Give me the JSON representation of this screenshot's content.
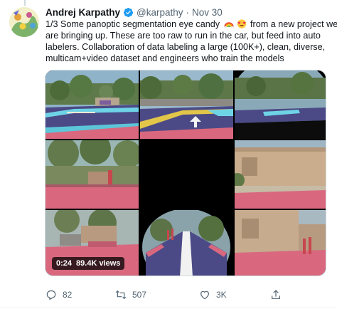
{
  "tweet": {
    "author_name": "Andrej Karpathy",
    "handle": "@karpathy",
    "separator": "·",
    "date": "Nov 30",
    "text_lines": [
      {
        "before": "1/3 Some panoptic segmentation eye candy ",
        "after": " from a new project we"
      },
      "are bringing up. These are too raw to run in the car, but feed into auto",
      "labelers. Collaboration of data labeling a large (100K+), clean, diverse,",
      "multicam+video dataset and engineers who train the models"
    ],
    "emojis": [
      "rainbow",
      "smiling-face-with-heart-eyes"
    ]
  },
  "video": {
    "duration": "0:24",
    "views": "89.4K views"
  },
  "actions": {
    "replies": "82",
    "retweets": "507",
    "likes": "3K"
  },
  "colors": {
    "text_primary": "#0f1419",
    "text_secondary": "#536471",
    "verified_blue": "#1d9bf0",
    "segmentation_road": "#4b4a86",
    "segmentation_sidewalk": "#d9687f",
    "segmentation_lane": "#6fd3e6"
  },
  "icons": [
    "reply-icon",
    "retweet-icon",
    "like-icon",
    "share-icon",
    "verified-badge-icon"
  ]
}
